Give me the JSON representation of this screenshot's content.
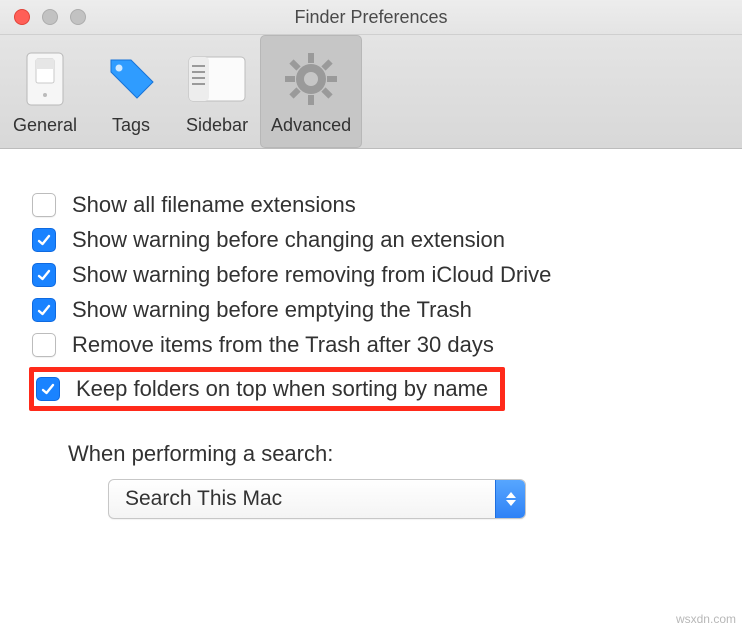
{
  "window": {
    "title": "Finder Preferences"
  },
  "tabs": {
    "general": {
      "label": "General"
    },
    "tags": {
      "label": "Tags"
    },
    "sidebar": {
      "label": "Sidebar"
    },
    "advanced": {
      "label": "Advanced"
    }
  },
  "options": {
    "show_ext": {
      "label": "Show all filename extensions",
      "checked": false
    },
    "warn_ext": {
      "label": "Show warning before changing an extension",
      "checked": true
    },
    "warn_icloud": {
      "label": "Show warning before removing from iCloud Drive",
      "checked": true
    },
    "warn_trash": {
      "label": "Show warning before emptying the Trash",
      "checked": true
    },
    "trash_30": {
      "label": "Remove items from the Trash after 30 days",
      "checked": false
    },
    "folders_top": {
      "label": "Keep folders on top when sorting by name",
      "checked": true
    }
  },
  "search": {
    "section_label": "When performing a search:",
    "selected": "Search This Mac"
  },
  "watermark": "wsxdn.com"
}
